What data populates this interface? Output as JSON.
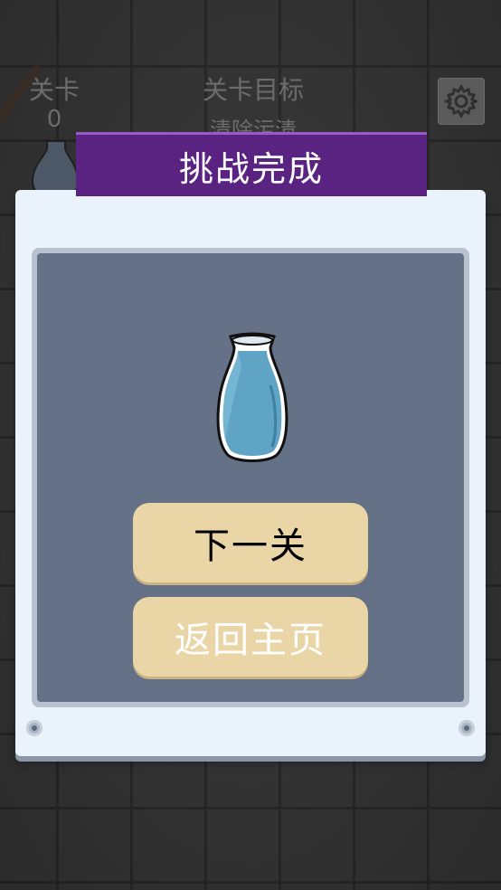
{
  "hud": {
    "level_label": "关卡",
    "level_value": "0",
    "goal_label": "关卡目标",
    "goal_sub": "清除污渍"
  },
  "settings": {
    "icon": "gear-icon"
  },
  "dialog": {
    "title": "挑战完成",
    "next_label": "下一关",
    "home_label": "返回主页"
  },
  "colors": {
    "banner": "#5a2382",
    "button": "#ead5a6",
    "panel": "#657186",
    "dialog": "#eaf2fb"
  }
}
